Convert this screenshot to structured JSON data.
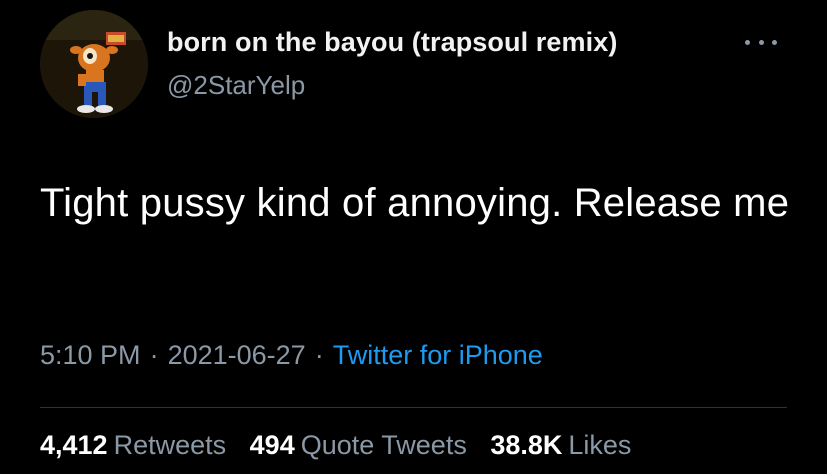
{
  "user": {
    "display_name": "born on the bayou (trapsoul remix)",
    "handle": "@2StarYelp",
    "avatar_icon": "avatar-cartoon-character"
  },
  "tweet": {
    "text": "Tight pussy kind of annoying. Release me",
    "time": "5:10 PM",
    "date": "2021-06-27",
    "separator": "·",
    "source": "Twitter for iPhone"
  },
  "stats": {
    "retweets_count": "4,412",
    "retweets_label": "Retweets",
    "quotes_count": "494",
    "quotes_label": "Quote Tweets",
    "likes_count": "38.8K",
    "likes_label": "Likes"
  },
  "colors": {
    "background": "#000000",
    "secondary_text": "#8b98a5",
    "link": "#1d9bf0"
  },
  "menu_icon": "more-horizontal-icon"
}
